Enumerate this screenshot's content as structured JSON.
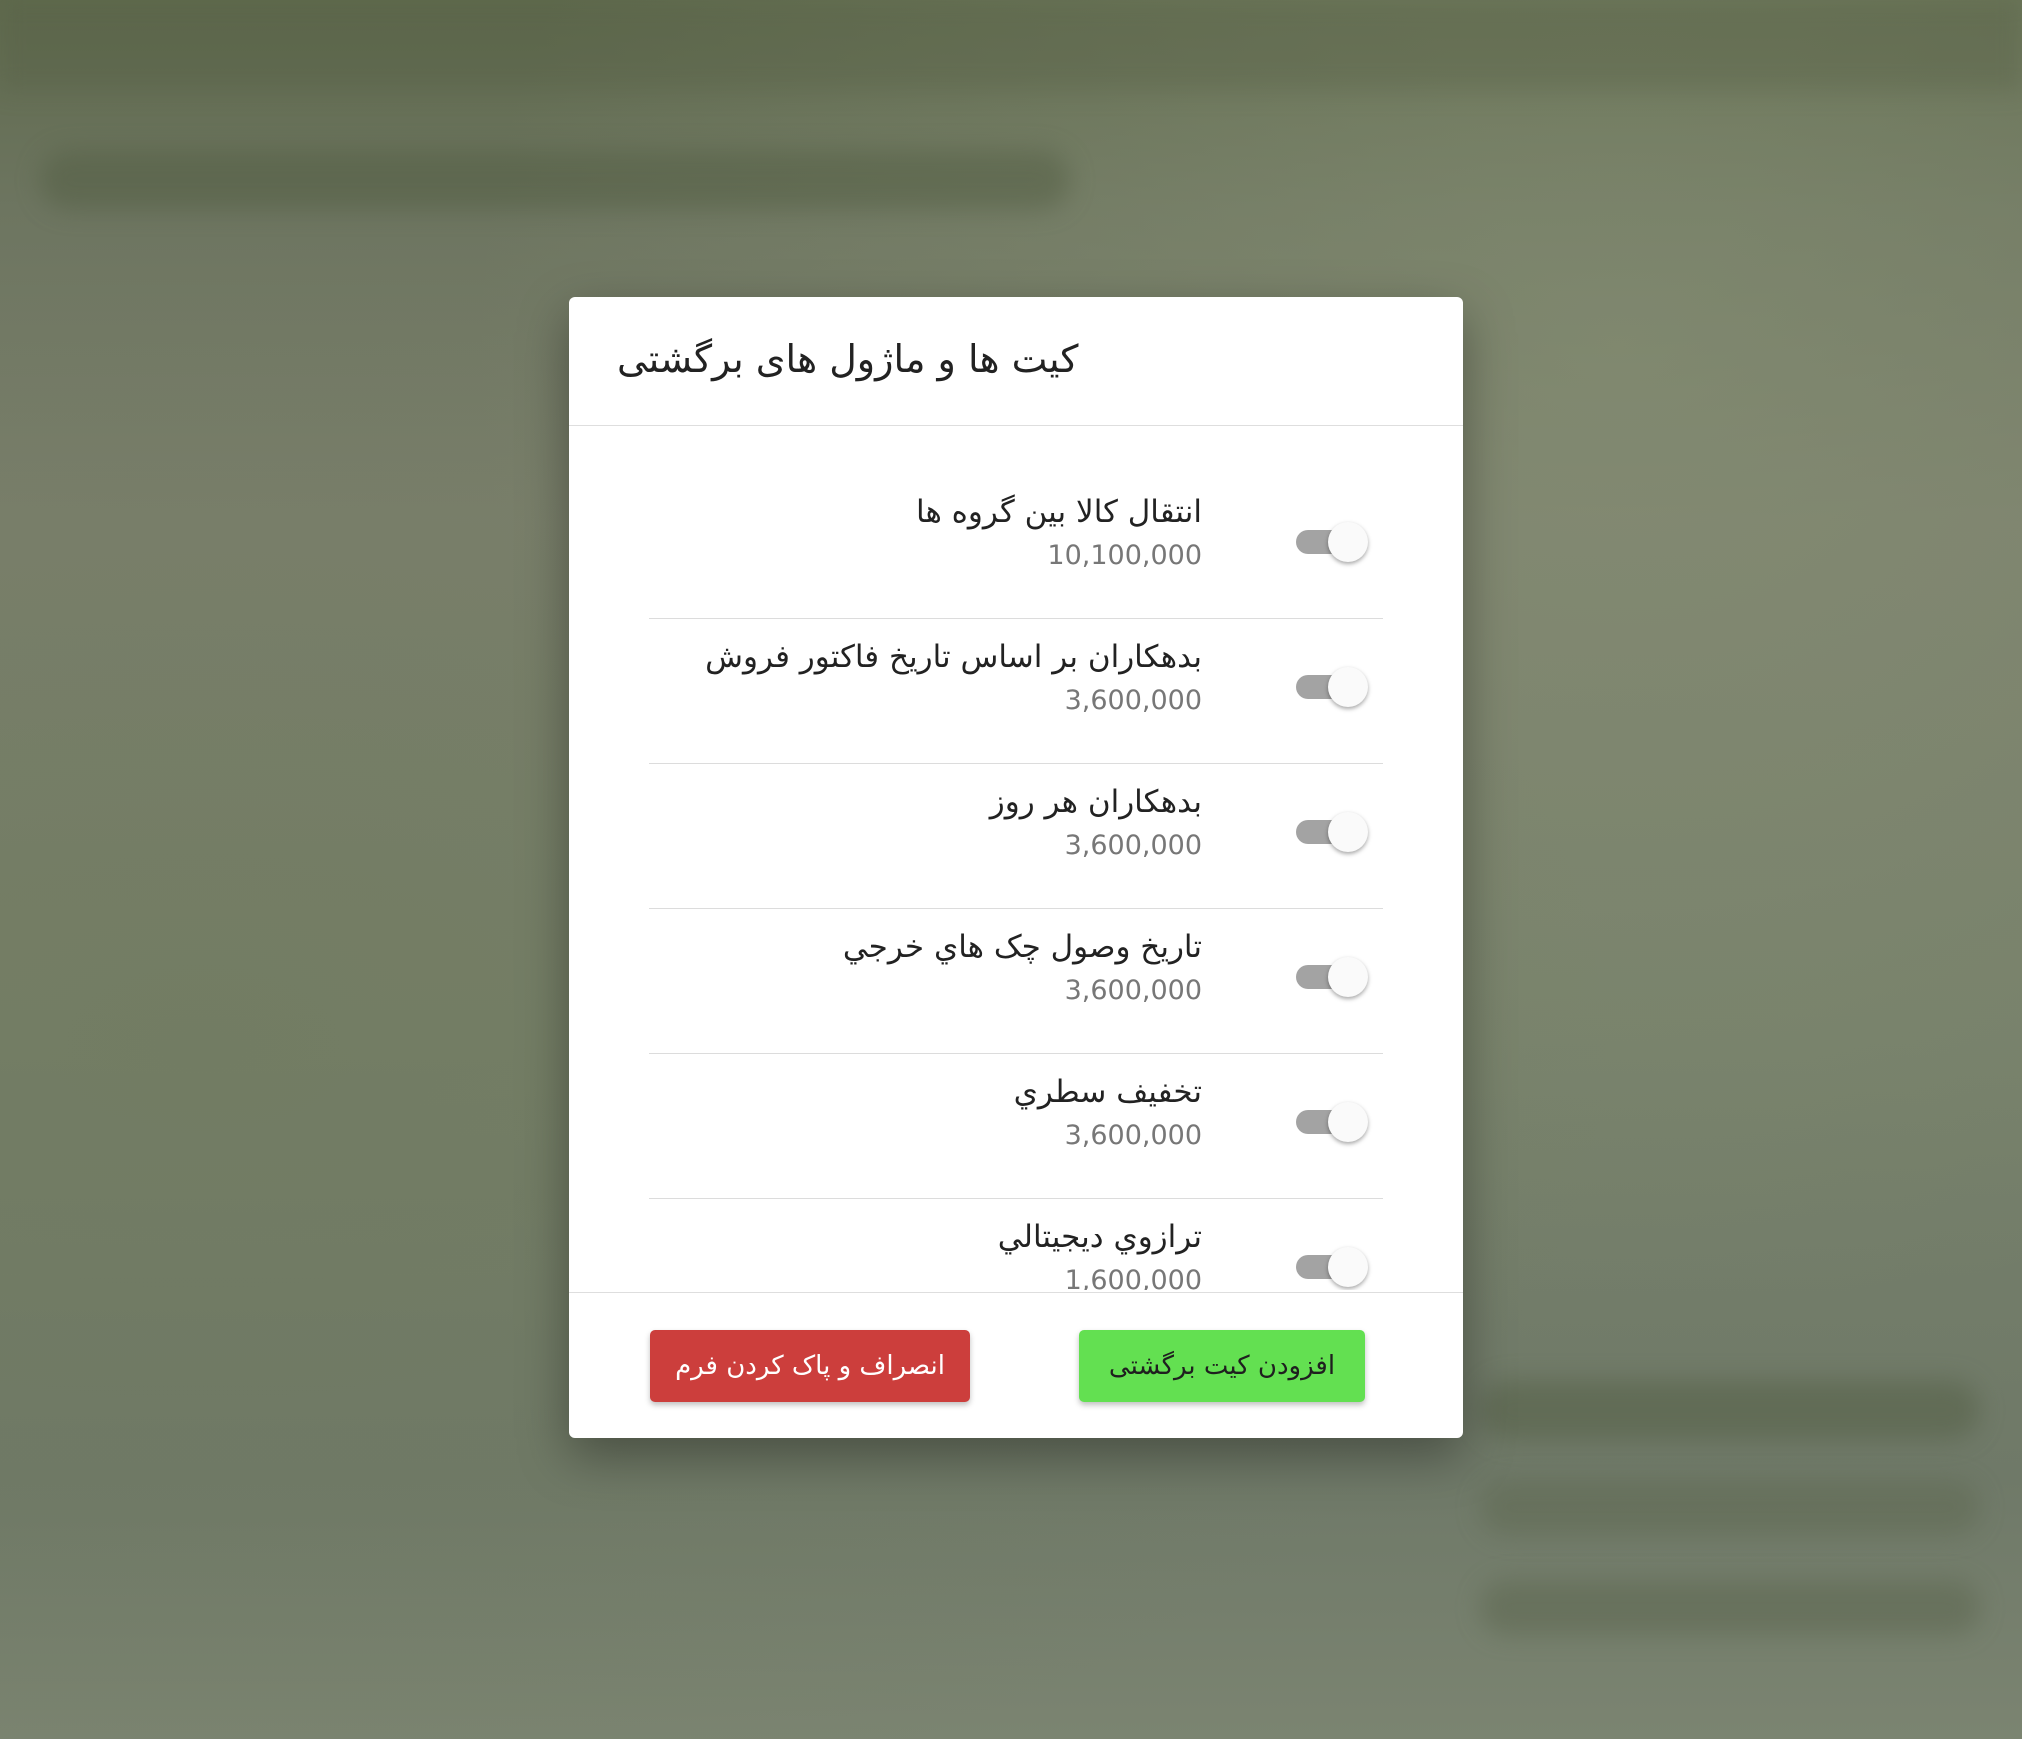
{
  "modal": {
    "title": "کیت ها و ماژول های برگشتی",
    "items": [
      {
        "name": "انتقال کالا بین گروه ها",
        "price": "10,100,000"
      },
      {
        "name": "بدهکاران بر اساس تاریخ فاکتور فروش",
        "price": "3,600,000"
      },
      {
        "name": "بدهکاران هر روز",
        "price": "3,600,000"
      },
      {
        "name": "تاريخ وصول چک هاي خرجي",
        "price": "3,600,000"
      },
      {
        "name": "تخفيف سطري",
        "price": "3,600,000"
      },
      {
        "name": "ترازوي ديجيتالي",
        "price": "1,600,000"
      }
    ],
    "add_button_label": "افزودن کیت برگشتی",
    "cancel_button_label": "انصراف و پاک کردن فرم"
  },
  "colors": {
    "add_button": "#63e051",
    "cancel_button": "#cc3e3c",
    "toggle_track": "#a3a3a3"
  }
}
